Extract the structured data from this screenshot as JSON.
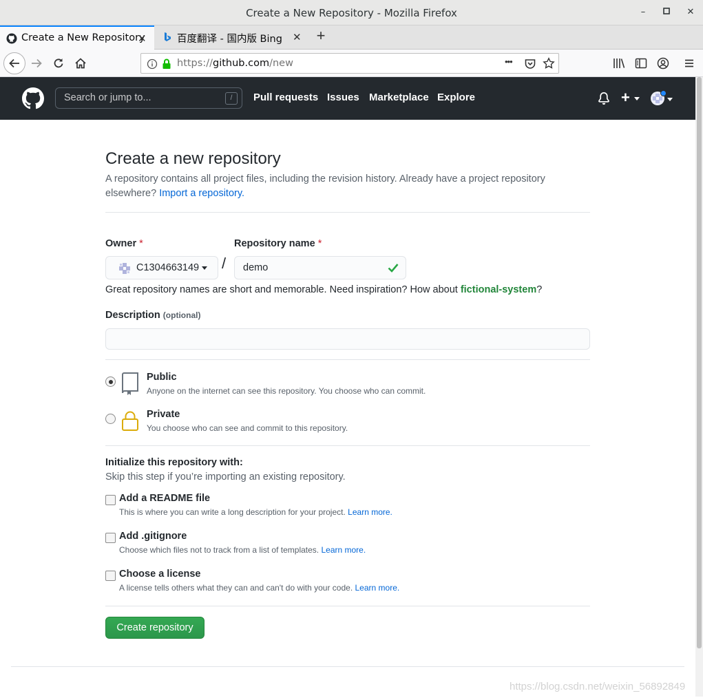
{
  "window": {
    "title": "Create a New Repository - Mozilla Firefox",
    "min": "–",
    "max": "□",
    "close": "✕"
  },
  "tabs": [
    {
      "label": "Create a New Repository",
      "close": "✕"
    },
    {
      "label": "百度翻译 - 国内版 Bing",
      "close": "✕"
    }
  ],
  "newtab": "+",
  "urlbar": {
    "scheme": "https://",
    "host": "github.com",
    "path": "/new",
    "more": "•••"
  },
  "gh": {
    "search_placeholder": "Search or jump to...",
    "slash": "/",
    "nav": [
      "Pull requests",
      "Issues",
      "Marketplace",
      "Explore"
    ],
    "plus": "+"
  },
  "page": {
    "title": "Create a new repository",
    "subtitle": "A repository contains all project files, including the revision history. Already have a project repository elsewhere?",
    "import_link": "Import a repository.",
    "owner_label": "Owner",
    "repo_label": "Repository name",
    "required": "*",
    "owner_name": "C1304663149",
    "separator": "/",
    "repo_value": "demo",
    "hint_text": "Great repository names are short and memorable. Need inspiration? How about",
    "hint_suggestion": "fictional-system",
    "hint_end": "?",
    "desc_label": "Description",
    "desc_optional": "(optional)",
    "public_title": "Public",
    "public_desc": "Anyone on the internet can see this repository. You choose who can commit.",
    "private_title": "Private",
    "private_desc": "You choose who can see and commit to this repository.",
    "init_title": "Initialize this repository with:",
    "init_sub": "Skip this step if you’re importing an existing repository.",
    "readme_title": "Add a README file",
    "readme_desc": "This is where you can write a long description for your project.",
    "gitignore_title": "Add .gitignore",
    "gitignore_desc": "Choose which files not to track from a list of templates.",
    "license_title": "Choose a license",
    "license_desc": "A license tells others what they can and can't do with your code.",
    "learn_more": "Learn more.",
    "create_button": "Create repository"
  },
  "watermark": "https://blog.csdn.net/weixin_56892849",
  "colors": {
    "accent_blue": "#0366d6",
    "success_green": "#2ea44f",
    "header_dark": "#24292e"
  }
}
